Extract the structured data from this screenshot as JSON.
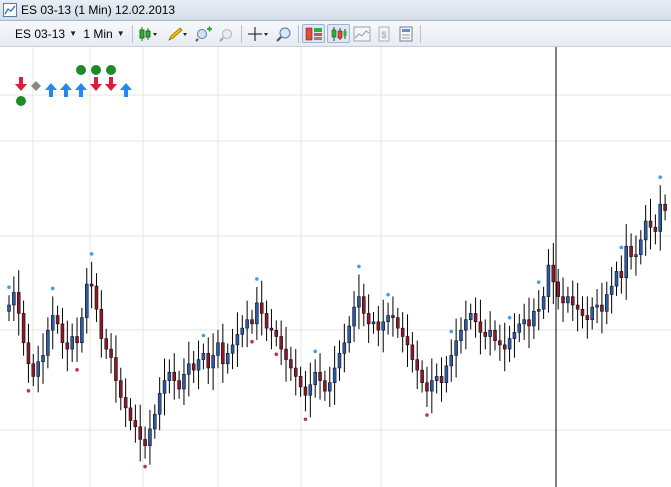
{
  "window": {
    "title": "ES 03-13 (1 Min)  12.02.2013"
  },
  "toolbar": {
    "instrument": "ES 03-13",
    "interval": "1 Min",
    "icons": [
      "bar-type-icon",
      "pencil-draw-icon",
      "zoom-in-icon",
      "zoom-out-icon",
      "crosshair-icon",
      "magnifier-icon",
      "chart-trader-icon",
      "data-box-icon",
      "indicators-icon",
      "strategies-icon",
      "properties-icon"
    ]
  },
  "colors": {
    "up_bar": "#2a5aa8",
    "down_bar": "#8a1a2a",
    "signal_up_dot": "#3fa0e8",
    "signal_down_dot": "#c0334a",
    "arrow_up": "#2488f0",
    "arrow_down": "#d81e3c",
    "diamond": "#888888",
    "circle": "#1e8a28",
    "grid": "#e6e6e6",
    "cursor_line": "#000000"
  },
  "legend_markers": [
    {
      "shape": "arrow-down",
      "col": 0
    },
    {
      "shape": "diamond",
      "col": 1
    },
    {
      "shape": "arrow-up",
      "col": 2
    },
    {
      "shape": "arrow-up",
      "col": 3
    },
    {
      "shape": "arrow-up",
      "col": 4
    },
    {
      "shape": "arrow-down",
      "col": 5
    },
    {
      "shape": "arrow-down",
      "col": 6
    },
    {
      "shape": "arrow-up",
      "col": 7
    }
  ],
  "legend_circles": [
    {
      "col": 0,
      "row": "below"
    },
    {
      "col": 4,
      "row": "above"
    },
    {
      "col": 5,
      "row": "above"
    },
    {
      "col": 6,
      "row": "above"
    }
  ],
  "chart_data": {
    "type": "ohlc",
    "price_path": [
      2,
      2.6,
      1.6,
      0.2,
      -0.8,
      -1.4,
      -0.7,
      -0.4,
      0.8,
      1.5,
      1.1,
      0.2,
      -0.1,
      0.5,
      0.2,
      1.4,
      3,
      2.9,
      1.8,
      0.4,
      -0.1,
      -0.5,
      -1.6,
      -2.4,
      -2.9,
      -3.5,
      -3.8,
      -4.4,
      -4.7,
      -3.9,
      -3.2,
      -2.2,
      -1.6,
      -1.2,
      -1.6,
      -2.0,
      -1.3,
      -0.8,
      -1.1,
      -0.6,
      -0.3,
      -1.0,
      -0.4,
      0.2,
      -0.8,
      -0.3,
      0.1,
      0.6,
      0.9,
      1.3,
      1.1,
      2.1,
      1.6,
      0.9,
      0.8,
      0.5,
      -0.1,
      -0.6,
      -1.0,
      -1.4,
      -1.9,
      -2.3,
      -1.8,
      -1.2,
      -1.6,
      -2.1,
      -1.7,
      -1.0,
      -0.3,
      0.2,
      1.0,
      1.9,
      2.4,
      1.6,
      1.1,
      1.2,
      0.8,
      1.2,
      1.5,
      1.4,
      0.9,
      0.5,
      0.1,
      -0.6,
      -1.1,
      -1.7,
      -2.1,
      -1.6,
      -1.4,
      -1.7,
      -0.9,
      -0.4,
      0.3,
      0.8,
      1.3,
      1.6,
      1.2,
      0.7,
      0.5,
      0.8,
      0.3,
      0.1,
      -0.1,
      0.4,
      0.7,
      1.1,
      1.3,
      1.0,
      1.7,
      1.8,
      2.4,
      3.9,
      3.1,
      2.4,
      2.1,
      2.4,
      2.0,
      1.8,
      1.5,
      1.3,
      1.9,
      2.0,
      1.7,
      2.5,
      2.9,
      3.6,
      3.3,
      4.8,
      4.3,
      4.4,
      5.1,
      6.0,
      5.7,
      5.5,
      6.8,
      6.5
    ],
    "signal_dots": [
      {
        "bar": 0,
        "type": "high"
      },
      {
        "bar": 4,
        "type": "low"
      },
      {
        "bar": 9,
        "type": "high"
      },
      {
        "bar": 14,
        "type": "low"
      },
      {
        "bar": 17,
        "type": "high"
      },
      {
        "bar": 28,
        "type": "low"
      },
      {
        "bar": 40,
        "type": "high"
      },
      {
        "bar": 50,
        "type": "low"
      },
      {
        "bar": 51,
        "type": "high"
      },
      {
        "bar": 55,
        "type": "low"
      },
      {
        "bar": 61,
        "type": "low"
      },
      {
        "bar": 63,
        "type": "high"
      },
      {
        "bar": 72,
        "type": "high"
      },
      {
        "bar": 78,
        "type": "high"
      },
      {
        "bar": 86,
        "type": "low"
      },
      {
        "bar": 91,
        "type": "high"
      },
      {
        "bar": 103,
        "type": "high"
      },
      {
        "bar": 109,
        "type": "high"
      },
      {
        "bar": 126,
        "type": "high"
      },
      {
        "bar": 134,
        "type": "high"
      }
    ]
  }
}
